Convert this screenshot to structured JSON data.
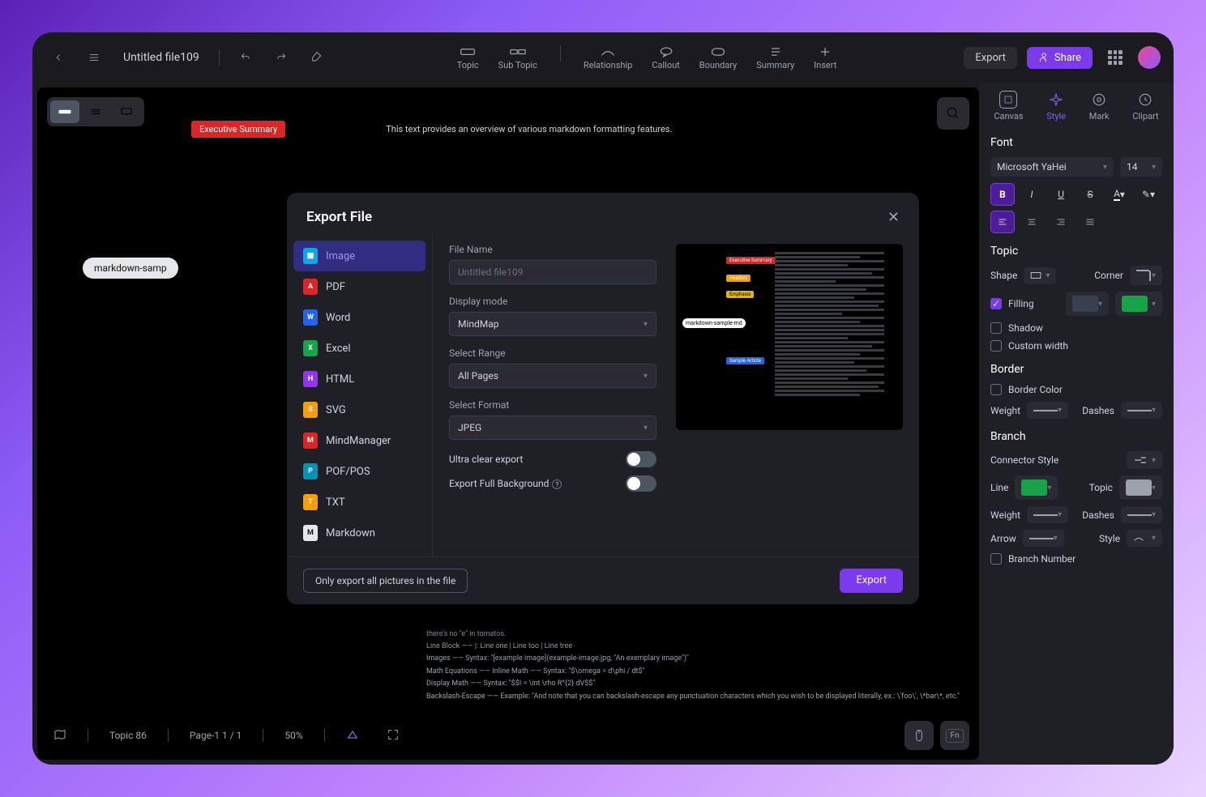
{
  "header": {
    "file_title": "Untitled file109",
    "export_btn": "Export",
    "share_btn": "Share"
  },
  "toolbar": {
    "items": [
      "Topic",
      "Sub Topic",
      "Relationship",
      "Callout",
      "Boundary",
      "Summary",
      "Insert"
    ]
  },
  "canvas": {
    "exec_summary": "Executive Summary",
    "overview": "This text provides an overview of various markdown formatting features.",
    "root_node": "markdown-samp",
    "bottom_snippets": [
      "there's no \"e\" in tomatos.",
      "Line Block —— |: Line one | Line too | Line tree",
      "Images —— Syntax: \"[example image](example-image.jpg, \"An exemplary image\")\"",
      "Math Equations —— Inline Math —— Syntax: \"$\\omega = d\\phi / dt$\"",
      "                      Display Math —— Syntax: \"$$I = \\int \\rho R^{2} dV$$\"",
      "Backslash-Escape —— Example: \"And note that you can backslash-escape any punctuation characters which you wish to be displayed literally, ex.: \\'foo\\', \\*bar\\*, etc.\""
    ]
  },
  "status": {
    "topic_count": "Topic 86",
    "page_info": "Page-1  1 / 1",
    "zoom": "50%"
  },
  "panel": {
    "tabs": [
      "Canvas",
      "Style",
      "Mark",
      "Clipart"
    ],
    "active_tab": "Style",
    "font_section": "Font",
    "font_family": "Microsoft YaHei",
    "font_size": "14",
    "topic_section": "Topic",
    "shape_label": "Shape",
    "corner_label": "Corner",
    "filling_label": "Filling",
    "shadow_label": "Shadow",
    "custom_width_label": "Custom width",
    "border_section": "Border",
    "border_color_label": "Border Color",
    "weight_label": "Weight",
    "dashes_label": "Dashes",
    "branch_section": "Branch",
    "connector_label": "Connector Style",
    "line_label": "Line",
    "topic_label": "Topic",
    "arrow_label": "Arrow",
    "style_label": "Style",
    "branch_number_label": "Branch Number"
  },
  "dialog": {
    "title": "Export File",
    "formats": [
      "Image",
      "PDF",
      "Word",
      "Excel",
      "HTML",
      "SVG",
      "MindManager",
      "POF/POS",
      "TXT",
      "Markdown"
    ],
    "active_format": "Image",
    "file_name_label": "File Name",
    "file_name_value": "Untitled file109",
    "display_mode_label": "Display mode",
    "display_mode_value": "MindMap",
    "select_range_label": "Select Range",
    "select_range_value": "All Pages",
    "select_format_label": "Select Format",
    "select_format_value": "JPEG",
    "ultra_clear_label": "Ultra clear export",
    "export_full_bg_label": "Export Full Background",
    "only_pictures_btn": "Only export all pictures in the file",
    "export_btn": "Export",
    "preview_root": "markdown-sample-md"
  }
}
